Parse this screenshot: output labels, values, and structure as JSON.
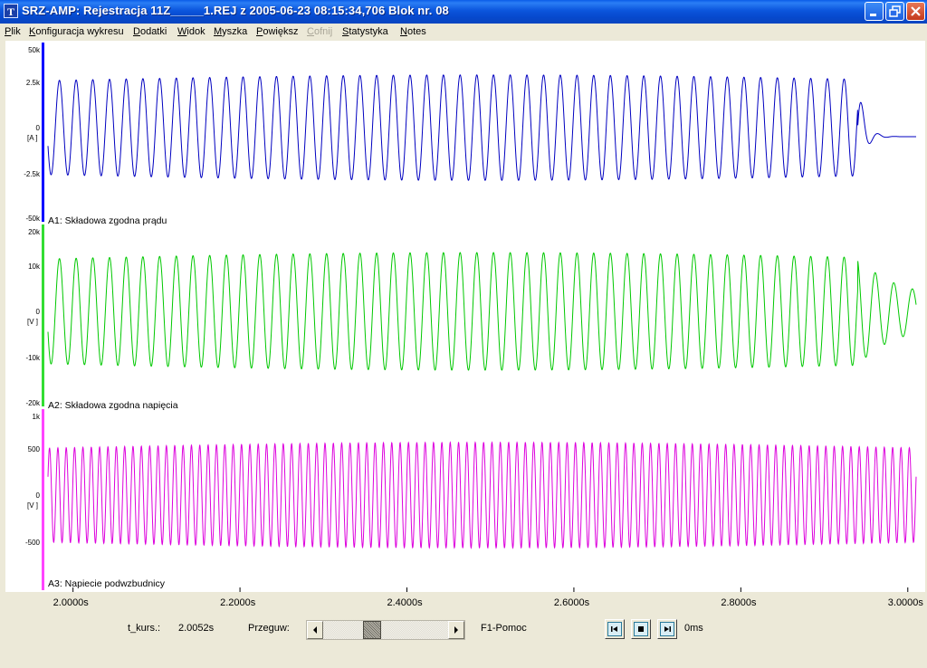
{
  "window": {
    "title": "SRZ-AMP: Rejestracja 11Z_____1.REJ z 2005-06-23 08:15:34,706 Blok nr.  08",
    "icon_letter": "T"
  },
  "menu": [
    {
      "label": "Plik",
      "underline": "P",
      "rest": "lik",
      "enabled": true
    },
    {
      "label": "Konfiguracja wykresu",
      "underline": "K",
      "rest": "onfiguracja wykresu",
      "enabled": true
    },
    {
      "label": "Dodatki",
      "underline": "D",
      "rest": "odatki",
      "enabled": true
    },
    {
      "label": "Widok",
      "underline": "W",
      "rest": "idok",
      "enabled": true
    },
    {
      "label": "Myszka",
      "underline": "M",
      "rest": "yszka",
      "enabled": true
    },
    {
      "label": "Powiększ",
      "underline": "P",
      "rest": "owiększ",
      "enabled": true
    },
    {
      "label": "Cofnij",
      "underline": "C",
      "rest": "ofnij",
      "enabled": false
    },
    {
      "label": "Statystyka",
      "underline": "S",
      "rest": "tatystyka",
      "enabled": true
    },
    {
      "label": "Notes",
      "underline": "N",
      "rest": "otes",
      "enabled": true
    }
  ],
  "chart_data": [
    {
      "type": "line",
      "title": "A1: Składowa zgodna prądu",
      "color": "#0000c0",
      "axis_color": "#0000ff",
      "unit": "[A ]",
      "ytick_labels": [
        "50k",
        "2.5k",
        "0",
        "-2.5k",
        "-50k"
      ],
      "signal": {
        "frequency_hz": 50,
        "amplitude": 2.9,
        "amplitude_peak": 3.3,
        "decay_start_s": 2.94,
        "offset_after": -0.2
      },
      "xlim": [
        1.97,
        3.01
      ]
    },
    {
      "type": "line",
      "title": "A2: Składowa zgodna napięcia",
      "color": "#00c800",
      "axis_color": "#33dd33",
      "unit": "[V ]",
      "ytick_labels": [
        "20k",
        "10k",
        "0",
        "-10k",
        "-20k"
      ],
      "signal": {
        "frequency_hz": 50,
        "amplitude": 11000,
        "amplitude_peak": 12000,
        "decay_start_s": 2.94,
        "offset_after": 0
      },
      "xlim": [
        1.97,
        3.01
      ]
    },
    {
      "type": "line",
      "title": "A3: Napiecie podwzbudnicy",
      "color": "#dd00dd",
      "axis_color": "#ff44ff",
      "unit": "[V ]",
      "ytick_labels": [
        "1k",
        "500",
        "0",
        "-500"
      ],
      "signal": {
        "frequency_hz": 100,
        "amplitude": 520,
        "amplitude_peak": 560,
        "decay_start_s": null,
        "offset_after": 0
      },
      "xlim": [
        1.97,
        3.01
      ]
    }
  ],
  "xaxis": {
    "ticks": [
      {
        "value": 2.0,
        "label": "2.0000s"
      },
      {
        "value": 2.2,
        "label": "2.2000s"
      },
      {
        "value": 2.4,
        "label": "2.4000s"
      },
      {
        "value": 2.6,
        "label": "2.6000s"
      },
      {
        "value": 2.8,
        "label": "2.8000s"
      },
      {
        "value": 3.0,
        "label": "3.0000s"
      }
    ],
    "cursor_value": 1.9702
  },
  "controls": {
    "cursor_label": "t_kurs.:",
    "cursor_value": "2.0052s",
    "scroll_label": "Przeguw:",
    "help_label": "F1-Pomoc",
    "time_value": "0ms"
  }
}
